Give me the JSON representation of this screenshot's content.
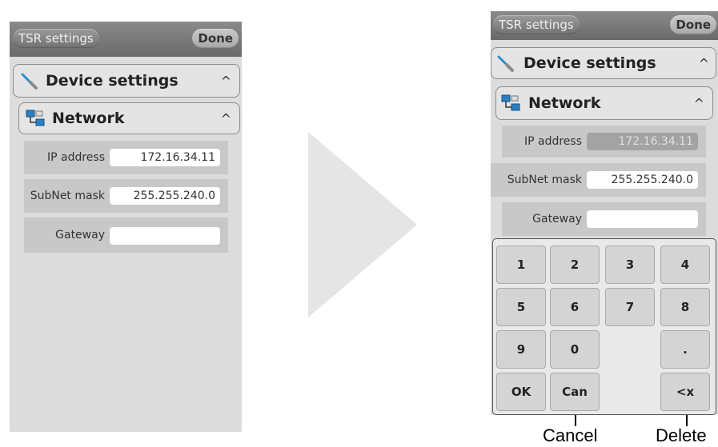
{
  "colors": {
    "panel_bg": "#dcdcdc",
    "header_bg": "#7a7a7a",
    "row_bg": "#c8c8c8",
    "field_bg": "#ffffff",
    "field_disabled_bg": "#a3a3a3",
    "key_bg": "#d4d4d4",
    "arrow": "#e5e5e5"
  },
  "before": {
    "header": {
      "title": "TSR settings",
      "done_label": "Done"
    },
    "device_section": {
      "title": "Device settings",
      "caret": "^",
      "icon": "screwdriver-icon"
    },
    "network_section": {
      "title": "Network",
      "caret": "^",
      "icon": "network-computers-icon"
    },
    "fields": {
      "ip": {
        "label": "IP address",
        "value": "172.16.34.11"
      },
      "subnet": {
        "label": "SubNet mask",
        "value": "255.255.240.0"
      },
      "gateway": {
        "label": "Gateway",
        "value": ""
      }
    }
  },
  "after": {
    "header": {
      "title": "TSR settings",
      "done_label": "Done"
    },
    "device_section": {
      "title": "Device settings",
      "caret": "^",
      "icon": "screwdriver-icon"
    },
    "network_section": {
      "title": "Network",
      "caret": "^",
      "icon": "network-computers-icon"
    },
    "fields": {
      "ip": {
        "label": "IP address",
        "value": "172.16.34.11",
        "disabled": true
      },
      "subnet": {
        "label": "SubNet mask",
        "value": "255.255.240.0"
      },
      "gateway": {
        "label": "Gateway",
        "value": ""
      }
    },
    "keypad": {
      "keys": [
        "1",
        "2",
        "3",
        "4",
        "5",
        "6",
        "7",
        "8",
        "9",
        "0",
        ".",
        "OK",
        "Can",
        "<x"
      ]
    }
  },
  "transition_arrow": "arrow-right-icon",
  "callouts": {
    "cancel": "Cancel",
    "delete": "Delete"
  }
}
